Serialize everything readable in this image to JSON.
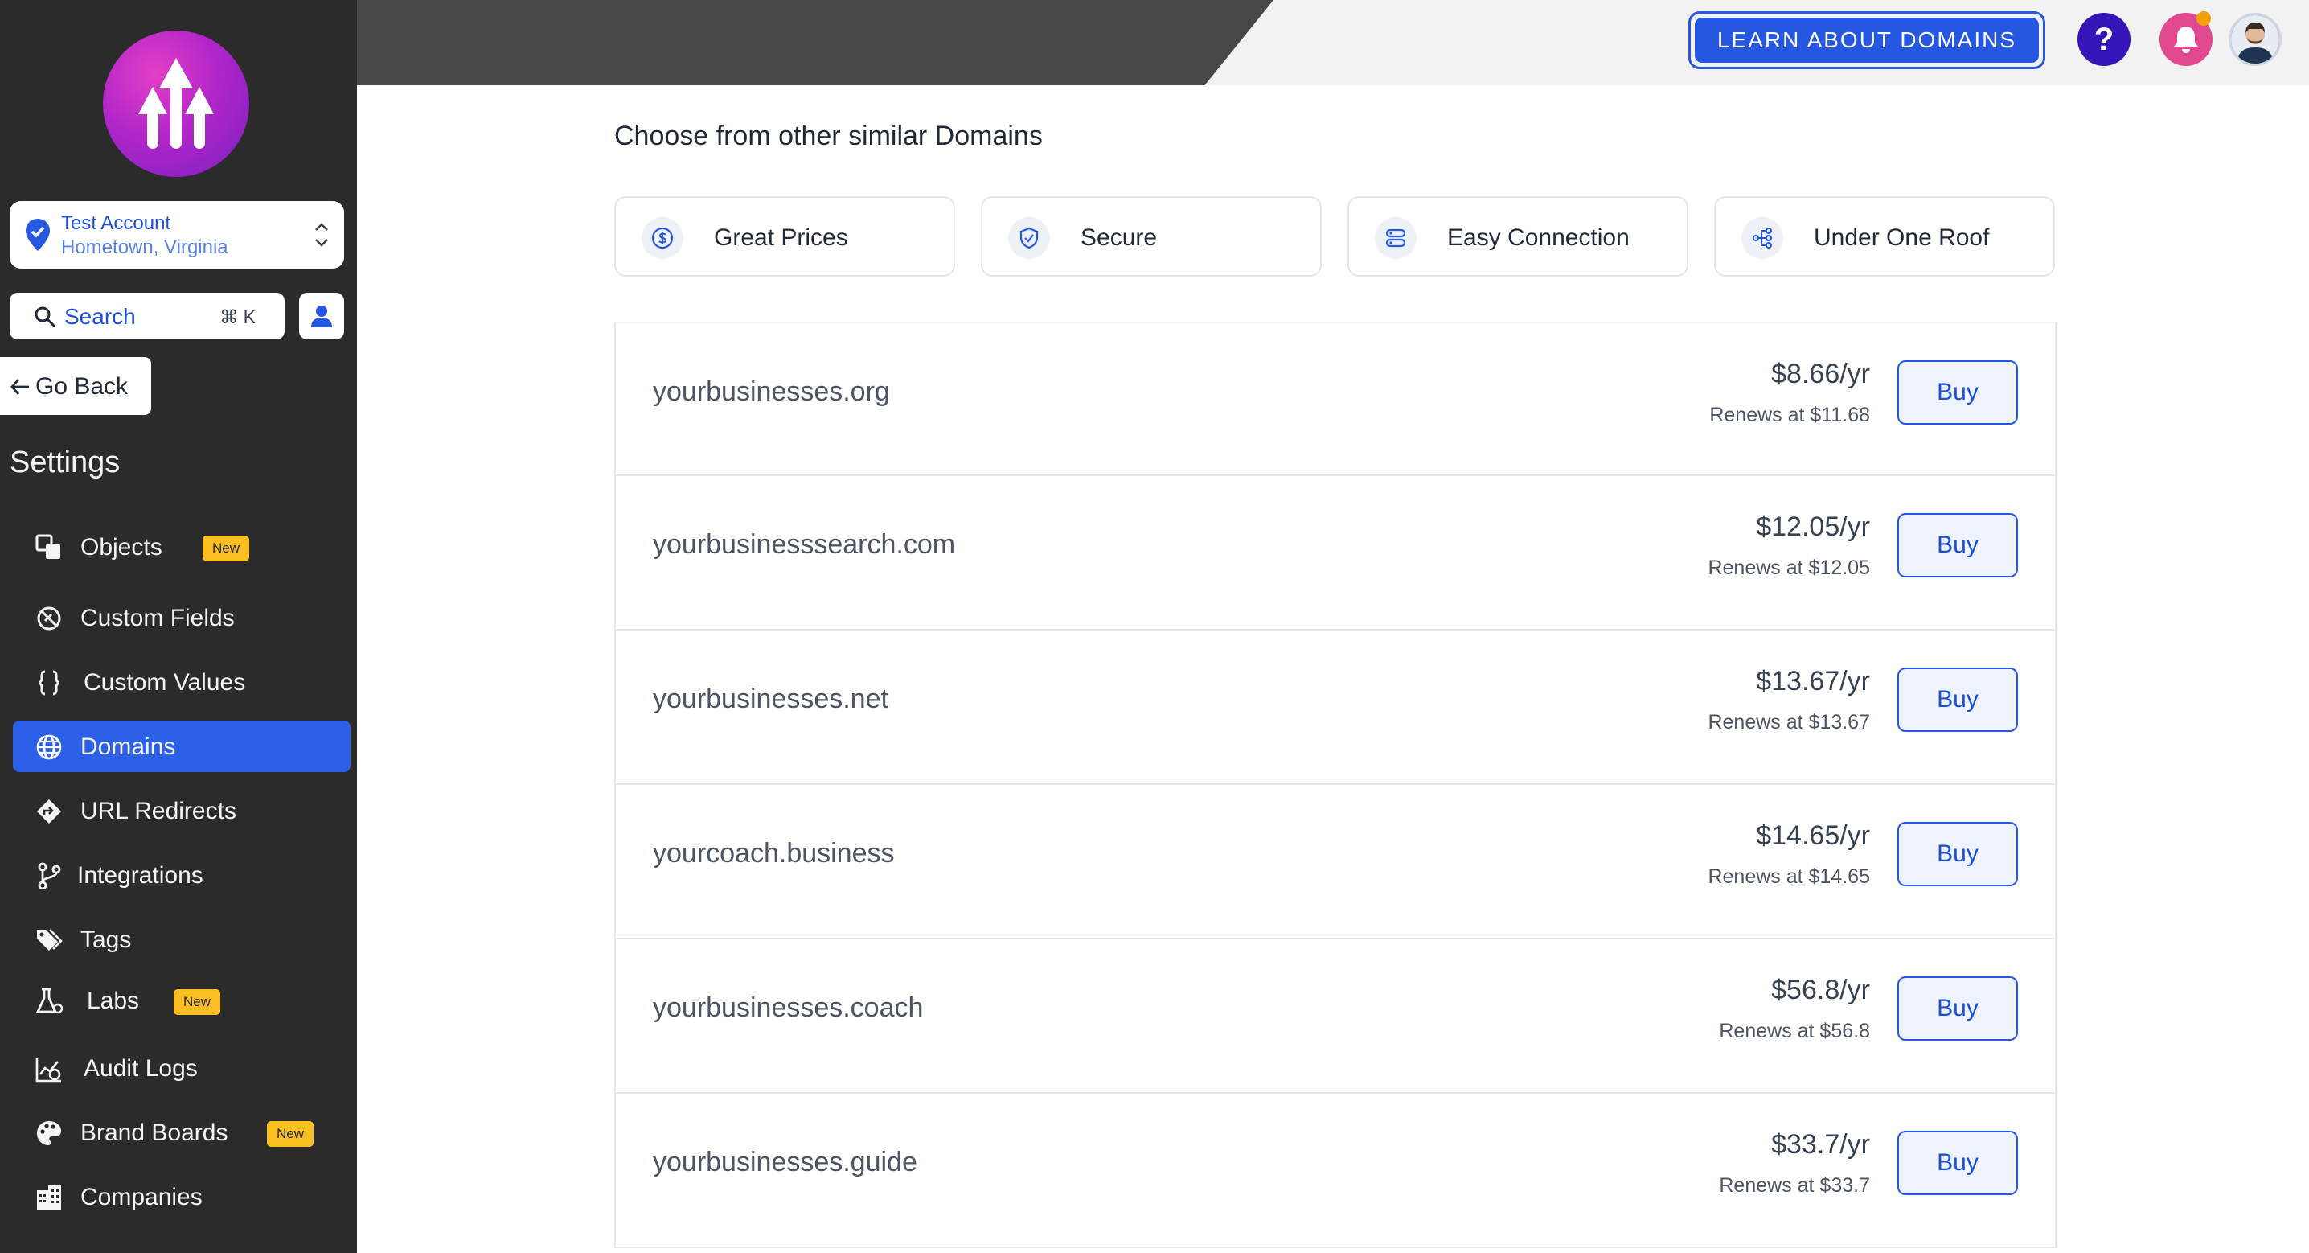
{
  "account": {
    "name": "Test Account",
    "location": "Hometown, Virginia"
  },
  "search": {
    "label": "Search",
    "shortcut": "⌘ K"
  },
  "go_back": "Go Back",
  "settings_title": "Settings",
  "nav": [
    {
      "label": "Objects",
      "icon": "objects-icon",
      "badge": "New"
    },
    {
      "label": "Custom Fields",
      "icon": "custom-fields-icon"
    },
    {
      "label": "Custom Values",
      "icon": "braces-icon"
    },
    {
      "label": "Domains",
      "icon": "globe-icon",
      "active": true
    },
    {
      "label": "URL Redirects",
      "icon": "redirect-icon"
    },
    {
      "label": "Integrations",
      "icon": "branch-icon"
    },
    {
      "label": "Tags",
      "icon": "tags-icon"
    },
    {
      "label": "Labs",
      "icon": "flask-icon",
      "badge": "New"
    },
    {
      "label": "Audit Logs",
      "icon": "audit-icon"
    },
    {
      "label": "Brand Boards",
      "icon": "palette-icon",
      "badge": "New"
    },
    {
      "label": "Companies",
      "icon": "building-icon"
    }
  ],
  "header": {
    "learn_button": "LEARN ABOUT DOMAINS",
    "help": "?"
  },
  "main": {
    "heading": "Choose from other similar Domains",
    "features": [
      {
        "label": "Great Prices",
        "icon": "dollar-icon"
      },
      {
        "label": "Secure",
        "icon": "shield-check-icon"
      },
      {
        "label": "Easy Connection",
        "icon": "connection-icon"
      },
      {
        "label": "Under One Roof",
        "icon": "share-nodes-icon"
      }
    ],
    "domains": [
      {
        "name": "yourbusinesses.org",
        "price": "$8.66/yr",
        "renew": "Renews at $11.68",
        "buy": "Buy"
      },
      {
        "name": "yourbusinesssearch.com",
        "price": "$12.05/yr",
        "renew": "Renews at $12.05",
        "buy": "Buy"
      },
      {
        "name": "yourbusinesses.net",
        "price": "$13.67/yr",
        "renew": "Renews at $13.67",
        "buy": "Buy"
      },
      {
        "name": "yourcoach.business",
        "price": "$14.65/yr",
        "renew": "Renews at $14.65",
        "buy": "Buy"
      },
      {
        "name": "yourbusinesses.coach",
        "price": "$56.8/yr",
        "renew": "Renews at $56.8",
        "buy": "Buy"
      },
      {
        "name": "yourbusinesses.guide",
        "price": "$33.7/yr",
        "renew": "Renews at $33.7",
        "buy": "Buy"
      }
    ]
  },
  "colors": {
    "primary": "#2557e0",
    "sidebar": "#2b2b2b",
    "badge": "#fbbf24",
    "notification": "#e0488f"
  }
}
